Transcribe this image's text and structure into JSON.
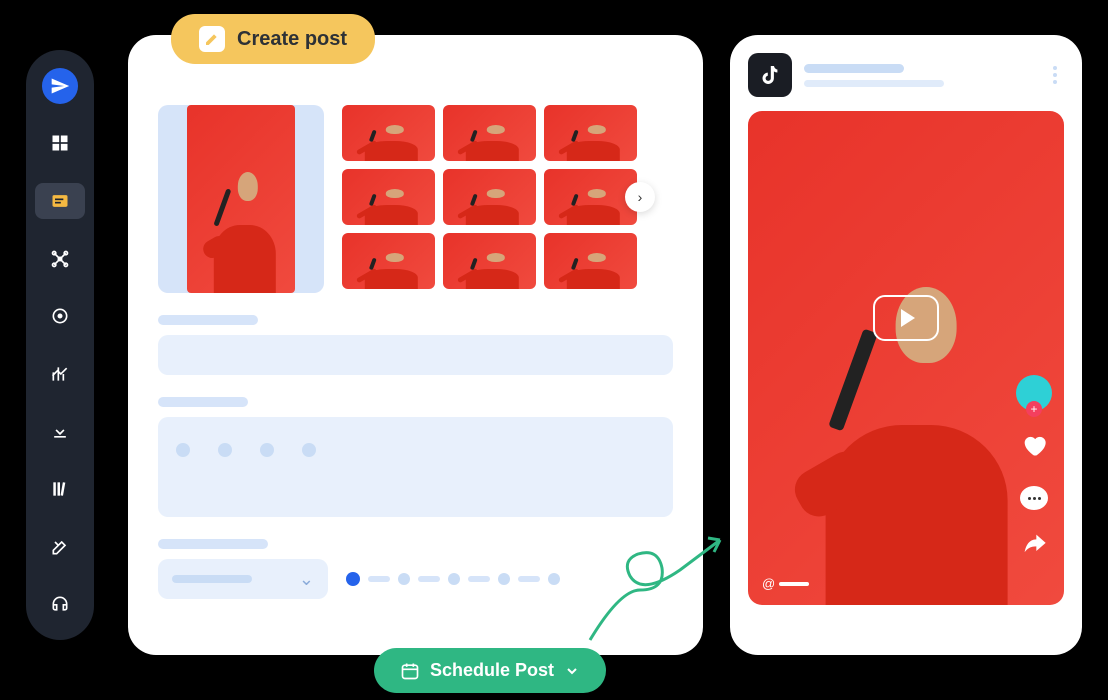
{
  "sidebar": {
    "items": [
      "send",
      "dashboard",
      "posts",
      "network",
      "target",
      "analytics",
      "download",
      "library",
      "tools",
      "support"
    ]
  },
  "create": {
    "label": "Create post"
  },
  "editor": {
    "thumb_count": 9,
    "stepper_total": 5,
    "stepper_active": 1
  },
  "schedule": {
    "label": "Schedule Post"
  },
  "preview": {
    "platform": "tiktok",
    "handle_prefix": "@",
    "actions": [
      "avatar",
      "heart",
      "comment",
      "share"
    ]
  },
  "colors": {
    "accent_blue": "#2563eb",
    "green": "#2fb783",
    "yellow": "#f5c65d",
    "red": "#e8332a"
  }
}
